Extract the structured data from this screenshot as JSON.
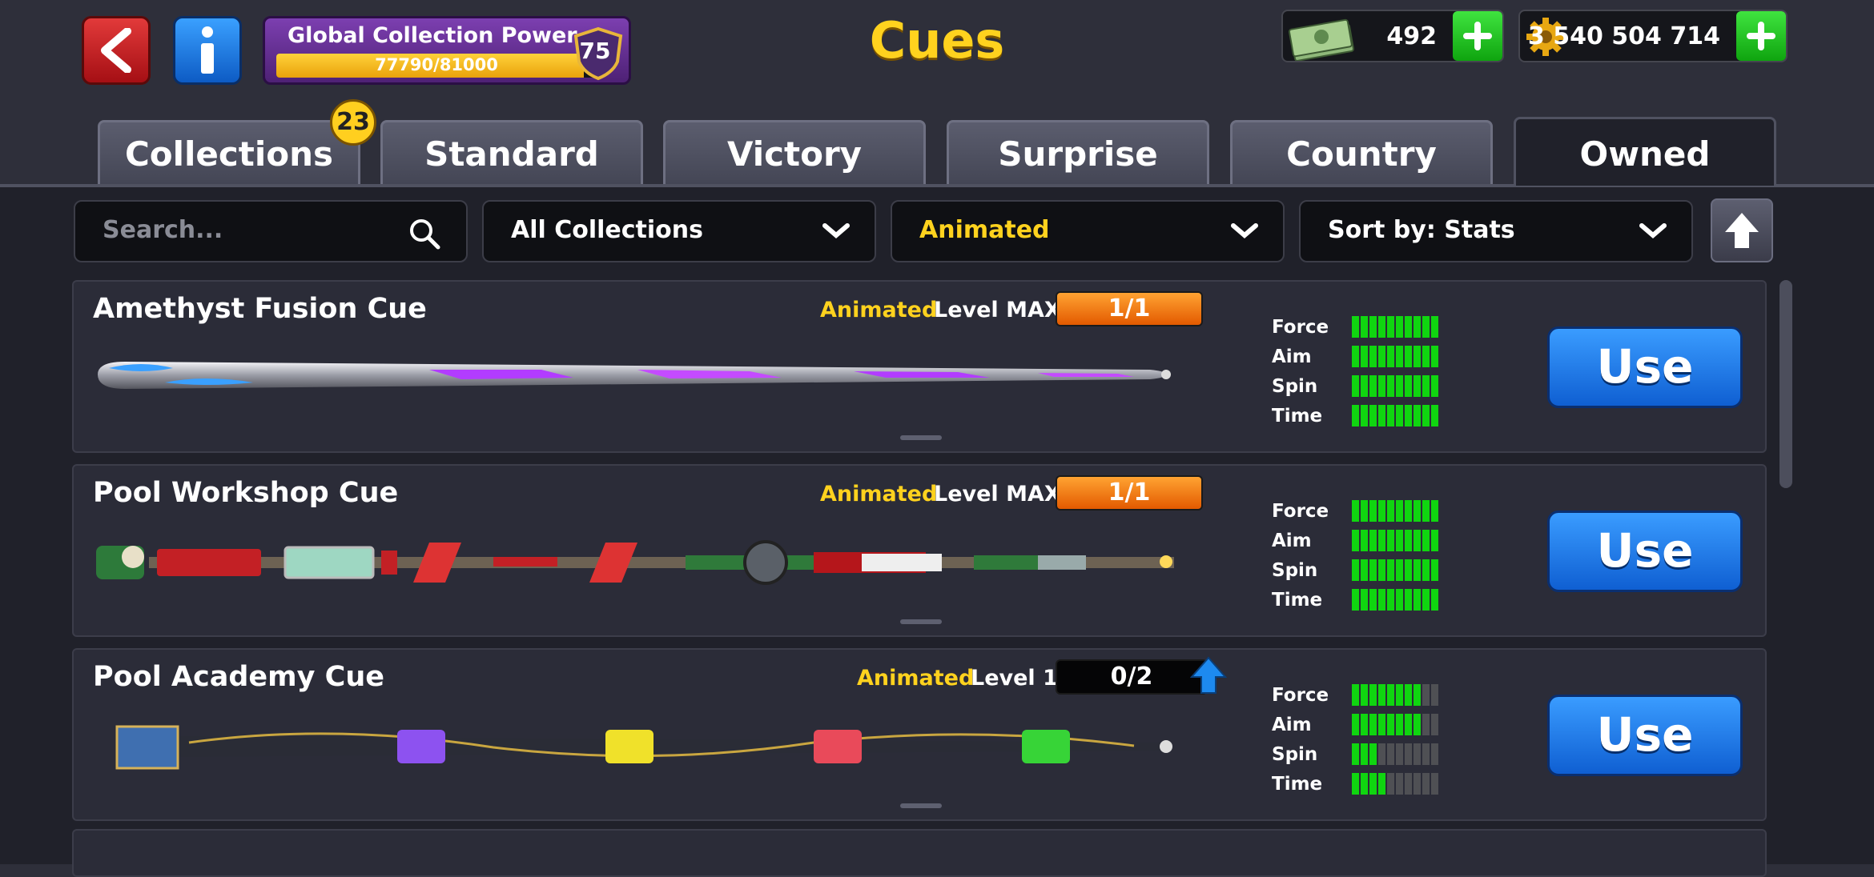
{
  "header": {
    "title": "Cues",
    "collection_power": {
      "label": "Global Collection Power",
      "progress_text": "77790/81000",
      "progress_fraction": 0.96,
      "level": "75"
    },
    "cash": "492",
    "coins": "3 540 504 714"
  },
  "tabs": [
    {
      "label": "Collections",
      "badge": "23",
      "active": false
    },
    {
      "label": "Standard",
      "active": false
    },
    {
      "label": "Victory",
      "active": false
    },
    {
      "label": "Surprise",
      "active": false
    },
    {
      "label": "Country",
      "active": false
    },
    {
      "label": "Owned",
      "active": true
    }
  ],
  "filters": {
    "search_placeholder": "Search...",
    "collection": "All Collections",
    "type": "Animated",
    "sort": "Sort by: Stats"
  },
  "cues": [
    {
      "name": "Amethyst Fusion Cue",
      "tag": "Animated",
      "level": "Level MAX",
      "progress": "1/1",
      "upgradeable": false,
      "stats": [
        {
          "label": "Force",
          "value": 10
        },
        {
          "label": "Aim",
          "value": 10
        },
        {
          "label": "Spin",
          "value": 10
        },
        {
          "label": "Time",
          "value": 10
        }
      ],
      "button": "Use"
    },
    {
      "name": "Pool Workshop Cue",
      "tag": "Animated",
      "level": "Level MAX",
      "progress": "1/1",
      "upgradeable": false,
      "stats": [
        {
          "label": "Force",
          "value": 10
        },
        {
          "label": "Aim",
          "value": 10
        },
        {
          "label": "Spin",
          "value": 10
        },
        {
          "label": "Time",
          "value": 10
        }
      ],
      "button": "Use"
    },
    {
      "name": "Pool Academy Cue",
      "tag": "Animated",
      "level": "Level 1",
      "progress": "0/2",
      "upgradeable": true,
      "stats": [
        {
          "label": "Force",
          "value": 8
        },
        {
          "label": "Aim",
          "value": 8
        },
        {
          "label": "Spin",
          "value": 3
        },
        {
          "label": "Time",
          "value": 4
        }
      ],
      "button": "Use"
    }
  ],
  "colors": {
    "title": "#ffd21e",
    "stat_on": "#10d510",
    "stat_off": "#4f5054",
    "use_button": "#1f7ae8",
    "progress_max": "#ff8a1a"
  },
  "icons": [
    "back-icon",
    "info-icon",
    "shield-icon",
    "cash-icon",
    "coin-icon",
    "plus-icon",
    "search-icon",
    "chevron-down-icon",
    "arrow-up-icon"
  ]
}
